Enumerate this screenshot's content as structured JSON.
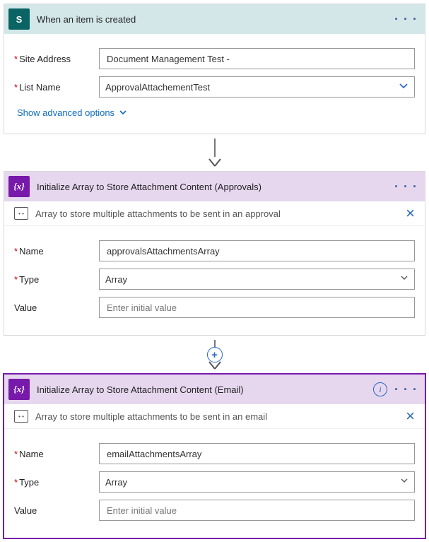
{
  "trigger": {
    "title": "When an item is created",
    "fields": {
      "site_label": "Site Address",
      "site_value": "Document Management Test -",
      "list_label": "List Name",
      "list_value": "ApprovalAttachementTest"
    },
    "advanced_link": "Show advanced options"
  },
  "action1": {
    "title": "Initialize Array to Store Attachment Content (Approvals)",
    "comment": "Array to store multiple attachments to be sent in an approval",
    "fields": {
      "name_label": "Name",
      "name_value": "approvalsAttachmentsArray",
      "type_label": "Type",
      "type_value": "Array",
      "value_label": "Value",
      "value_placeholder": "Enter initial value"
    }
  },
  "action2": {
    "title": "Initialize Array to Store Attachment Content (Email)",
    "comment": "Array to store multiple attachments to be sent in an email",
    "fields": {
      "name_label": "Name",
      "name_value": "emailAttachmentsArray",
      "type_label": "Type",
      "type_value": "Array",
      "value_label": "Value",
      "value_placeholder": "Enter initial value"
    }
  },
  "icons": {
    "sp_glyph": "S",
    "var_glyph": "{x}",
    "info_glyph": "i",
    "comment_glyph": "• •",
    "dots": "· · ·",
    "plus": "+"
  }
}
